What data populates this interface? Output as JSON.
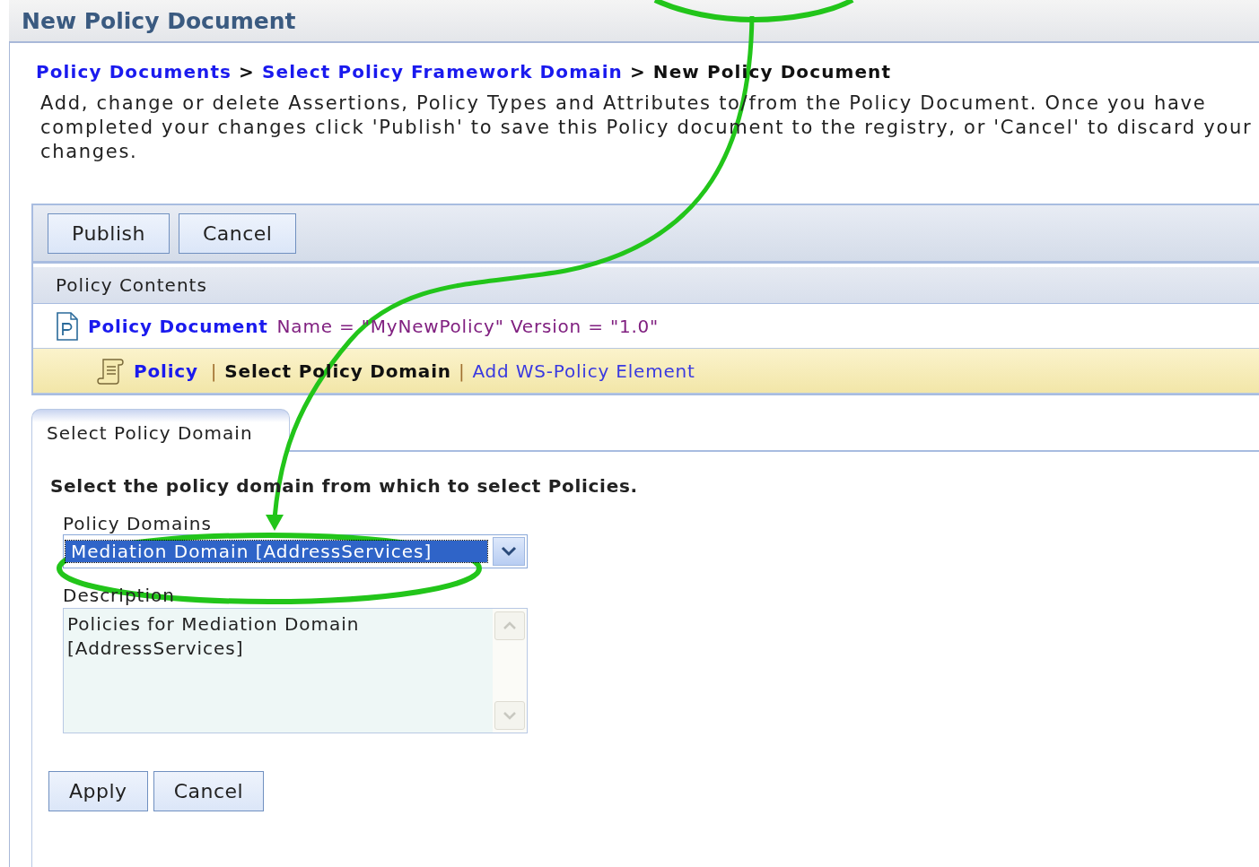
{
  "title": "New Policy Document",
  "breadcrumb": {
    "separator": ">",
    "items": [
      {
        "label": "Policy Documents",
        "kind": "link"
      },
      {
        "label": "Select Policy Framework Domain",
        "kind": "link"
      },
      {
        "label": "New Policy Document",
        "kind": "current"
      }
    ]
  },
  "intro": "Add, change or delete Assertions, Policy Types and Attributes to/from the Policy Document. Once you have completed your changes click 'Publish' to save this Policy document to the registry, or 'Cancel' to discard your changes.",
  "toolbar_buttons": [
    "Publish",
    "Cancel"
  ],
  "contents": {
    "header": "Policy Contents",
    "separator": "|",
    "rows": [
      {
        "kind": "document",
        "name": "Policy Document",
        "detail": "Name = \"MyNewPolicy\" Version = \"1.0\"",
        "selected": false
      },
      {
        "kind": "policy",
        "name": "Policy",
        "selected": true,
        "actions": [
          {
            "label": "Select Policy Domain",
            "kind": "current"
          },
          {
            "label": "Add WS-Policy Element",
            "kind": "link"
          }
        ]
      }
    ]
  },
  "tab": {
    "label": "Select Policy Domain",
    "selected": true
  },
  "form": {
    "instruction": "Select the policy domain from which to select Policies.",
    "domain": {
      "label": "Policy Domains",
      "value": "Mediation Domain [AddressServices]",
      "highlighted": true
    },
    "description": {
      "label": "Description",
      "value": "Policies for Mediation Domain\n[AddressServices]"
    },
    "buttons": [
      "Apply",
      "Cancel"
    ]
  }
}
